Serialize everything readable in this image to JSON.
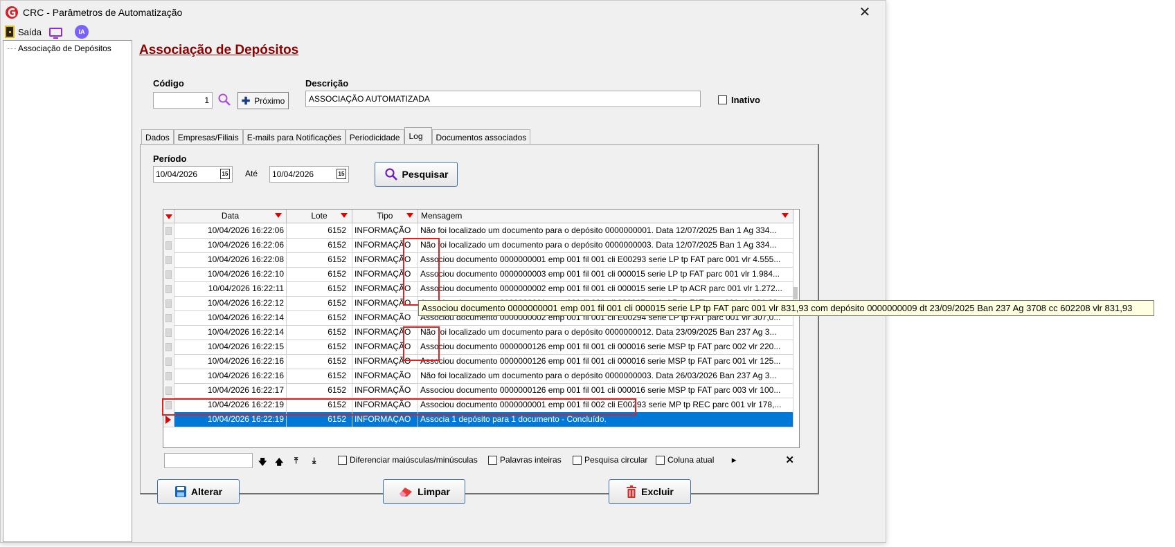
{
  "window": {
    "title": "CRC - Parâmetros de Automatização"
  },
  "toolbar": {
    "exit_label": "Saída",
    "ia_label": "IA"
  },
  "tree": {
    "items": [
      "Associação de Depósitos"
    ]
  },
  "page": {
    "title": "Associação de Depósitos"
  },
  "form": {
    "codigo_label": "Código",
    "codigo_value": "1",
    "proximo_label": "Próximo",
    "descricao_label": "Descrição",
    "descricao_value": "ASSOCIAÇÃO AUTOMATIZADA",
    "inativo_label": "Inativo"
  },
  "tabs": [
    {
      "label": "Dados",
      "active": false
    },
    {
      "label": "Empresas/Filiais",
      "active": false
    },
    {
      "label": "E-mails para Notificações",
      "active": false
    },
    {
      "label": "Periodicidade",
      "active": false
    },
    {
      "label": "Log",
      "active": true
    },
    {
      "label": "Documentos associados",
      "active": false
    }
  ],
  "log": {
    "periodo_label": "Período",
    "date_from": "10/04/2026",
    "ate_label": "Até",
    "date_to": "10/04/2026",
    "calendar_glyph": "15",
    "pesquisar_label": "Pesquisar",
    "columns": [
      "Data",
      "Lote",
      "Tipo",
      "Mensagem"
    ],
    "rows": [
      {
        "data": "10/04/2026 16:22:06",
        "lote": "6152",
        "tipo": "INFORMAÇÃO",
        "msg": "Não foi localizado um documento para o depósito 0000000001. Data 12/07/2025 Ban 1 Ag 334..."
      },
      {
        "data": "10/04/2026 16:22:06",
        "lote": "6152",
        "tipo": "INFORMAÇÃO",
        "msg": "Não foi localizado um documento para o depósito 0000000003. Data 12/07/2025 Ban 1 Ag 334..."
      },
      {
        "data": "10/04/2026 16:22:08",
        "lote": "6152",
        "tipo": "INFORMAÇÃO",
        "msg": "Associou documento 0000000001 emp 001 fil 001 cli E00293 serie LP tp FAT parc 001 vlr 4.555..."
      },
      {
        "data": "10/04/2026 16:22:10",
        "lote": "6152",
        "tipo": "INFORMAÇÃO",
        "msg": "Associou documento 0000000003 emp 001 fil 001 cli 000015 serie LP tp FAT parc 001 vlr 1.984..."
      },
      {
        "data": "10/04/2026 16:22:11",
        "lote": "6152",
        "tipo": "INFORMAÇÃO",
        "msg": "Associou documento 0000000002 emp 001 fil 001 cli 000015 serie LP tp ACR parc 001 vlr 1.272..."
      },
      {
        "data": "10/04/2026 16:22:12",
        "lote": "6152",
        "tipo": "INFORMAÇÃO",
        "msg": "Associou documento 0000000001 emp 001 fil 001 cli 000015 serie LP tp FAT parc 001 vlr 831,93..."
      },
      {
        "data": "10/04/2026 16:22:14",
        "lote": "6152",
        "tipo": "INFORMAÇÃO",
        "msg": "Associou documento 0000000002 emp 001 fil 001 cli E00294 serie LP tp FAT parc 001 vlr 307,0..."
      },
      {
        "data": "10/04/2026 16:22:14",
        "lote": "6152",
        "tipo": "INFORMAÇÃO",
        "msg": "Não foi localizado um documento para o depósito 0000000012. Data 23/09/2025 Ban 237 Ag 3..."
      },
      {
        "data": "10/04/2026 16:22:15",
        "lote": "6152",
        "tipo": "INFORMAÇÃO",
        "msg": "Associou documento 0000000126 emp 001 fil 001 cli 000016 serie MSP tp FAT parc 002 vlr 220..."
      },
      {
        "data": "10/04/2026 16:22:16",
        "lote": "6152",
        "tipo": "INFORMAÇÃO",
        "msg": "Associou documento 0000000126 emp 001 fil 001 cli 000016 serie MSP tp FAT parc 001 vlr 125..."
      },
      {
        "data": "10/04/2026 16:22:16",
        "lote": "6152",
        "tipo": "INFORMAÇÃO",
        "msg": "Não foi localizado um documento para o depósito 0000000003. Data 26/03/2026 Ban 237 Ag 3..."
      },
      {
        "data": "10/04/2026 16:22:17",
        "lote": "6152",
        "tipo": "INFORMAÇÃO",
        "msg": "Associou documento 0000000126 emp 001 fil 001 cli 000016 serie MSP tp FAT parc 003 vlr 100..."
      },
      {
        "data": "10/04/2026 16:22:19",
        "lote": "6152",
        "tipo": "INFORMAÇÃO",
        "msg": "Associou documento 0000000001 emp 001 fil 002 cli E00293 serie MP tp REC parc 001 vlr 178,..."
      },
      {
        "data": "10/04/2026 16:22:19",
        "lote": "6152",
        "tipo": "INFORMAÇÃO",
        "msg": "Associa 1 depósito para 1 documento - Concluído.",
        "selected": true
      }
    ],
    "tooltip": "Associou documento 0000000001 emp 001 fil 001 cli 000015 serie LP tp FAT parc 001 vlr 831,93 com depósito 0000000009 dt 23/09/2025 Ban 237 Ag 3708 cc 602208 vlr 831,93"
  },
  "searchbar": {
    "diferenciar": "Diferenciar maiúsculas/minúsculas",
    "palavras": "Palavras inteiras",
    "circular": "Pesquisa circular",
    "coluna": "Coluna atual"
  },
  "actions": {
    "alterar": "Alterar",
    "limpar": "Limpar",
    "excluir": "Excluir"
  },
  "colors": {
    "title_red": "#8b0000",
    "selection_blue": "#0078d7",
    "highlight_red": "#dd2222",
    "tooltip_bg": "#ffffe1"
  }
}
